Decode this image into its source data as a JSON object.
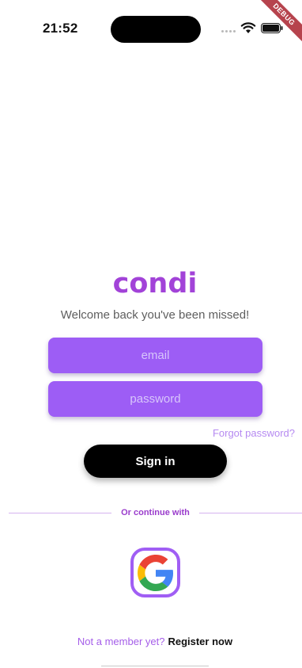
{
  "status_bar": {
    "time": "21:52",
    "debug_banner": "DEBUG"
  },
  "app": {
    "title": "condi",
    "welcome": "Welcome back you've been missed!"
  },
  "form": {
    "email_placeholder": "email",
    "password_placeholder": "password",
    "forgot_password": "Forgot password?",
    "signin_label": "Sign in"
  },
  "alt_login": {
    "divider_label": "Or continue with",
    "google_icon": "google-icon"
  },
  "register": {
    "prompt": "Not a member yet?",
    "link": "Register now"
  },
  "colors": {
    "brand": "#a243d8",
    "field_bg": "#9d5df5",
    "link": "#b68af1",
    "button_bg": "#000000"
  }
}
